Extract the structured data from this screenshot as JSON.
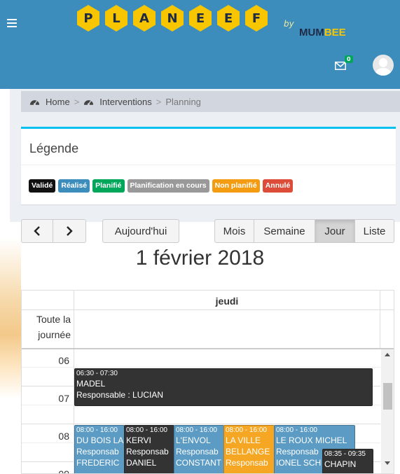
{
  "header": {
    "logo_letters": [
      "P",
      "L",
      "A",
      "N",
      "E",
      "E",
      "F"
    ],
    "by": "by",
    "mum": "MUM",
    "bee": "BEE",
    "mail_count": "0",
    "accent_color": "#3c8dbc",
    "logo_color": "#f7c600"
  },
  "breadcrumb": {
    "home": "Home",
    "interventions": "Interventions",
    "current": "Planning",
    "sep": ">"
  },
  "legend": {
    "title": "Légende",
    "labels": [
      {
        "text": "Validé",
        "color": "#111111"
      },
      {
        "text": "Réalisé",
        "color": "#3c8dbc"
      },
      {
        "text": "Planifié",
        "color": "#00a65a"
      },
      {
        "text": "Planification en cours",
        "color": "#999999"
      },
      {
        "text": "Non planifié",
        "color": "#f39c12"
      },
      {
        "text": "Annulé",
        "color": "#dd4b39"
      }
    ]
  },
  "toolbar": {
    "prev": "<",
    "next": ">",
    "today": "Aujourd'hui",
    "views": [
      "Mois",
      "Semaine",
      "Jour",
      "Liste"
    ],
    "active_view": "Jour"
  },
  "calendar": {
    "title": "1 février 2018",
    "day_header": "jeudi",
    "allday_label": "Toute la journée",
    "allday_line1": "Toute la",
    "allday_line2": "journée",
    "hours": [
      "06",
      "07",
      "08",
      "09"
    ],
    "events": [
      {
        "time": "06:30 - 07:30",
        "name": "MADEL",
        "resp": "Responsable : LUCIAN",
        "color": "#333333"
      },
      {
        "time": "08:00 - 16:00",
        "name": "DU BOIS LA",
        "resp": "Responsab",
        "extra": "FREDERIC",
        "color": "#5b9bc4"
      },
      {
        "time": "08:00 - 16:00",
        "name": "KERVI",
        "resp": "Responsab",
        "extra": "DANIEL",
        "color": "#333333"
      },
      {
        "time": "08:00 - 16:00",
        "name": "L'ENVOL",
        "resp": "Responsab",
        "extra": "CONSTANT",
        "color": "#5b9bc4"
      },
      {
        "time": "08:00 - 16:00",
        "name": "LA VILLE",
        "resp": "BELLANGE",
        "extra": "Responsab",
        "color": "#f5a623"
      },
      {
        "time": "08:00 - 16:00",
        "name": "LE ROUX MICHEL",
        "resp": "Responsab",
        "extra": "IONEL SCH",
        "color": "#5b9bc4"
      },
      {
        "time": "08:35 - 09:35",
        "name": "CHAPIN",
        "resp": "",
        "extra": "",
        "color": "#333333"
      }
    ]
  }
}
